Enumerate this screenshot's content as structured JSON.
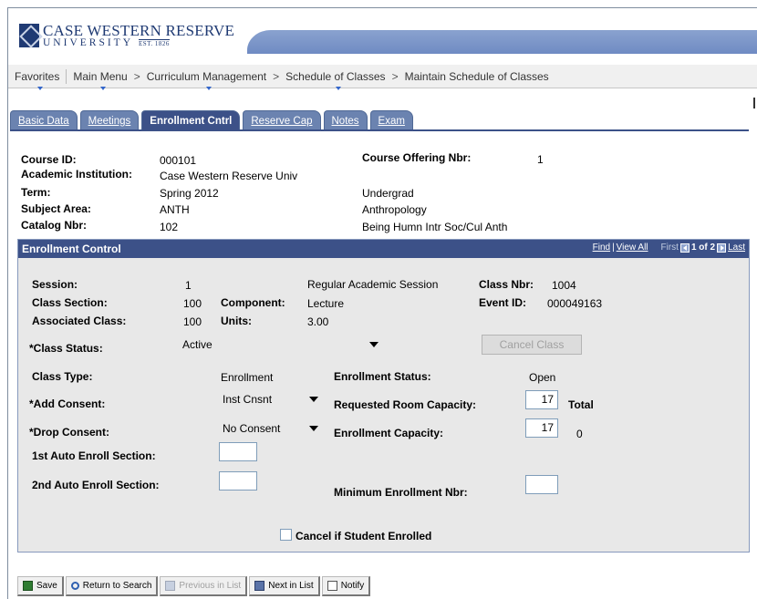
{
  "logo": {
    "line1": "CASE WESTERN RESERVE",
    "line2": "UNIVERSITY",
    "est": "EST. 1826"
  },
  "breadcrumb": {
    "favorites": "Favorites",
    "main_menu": "Main Menu",
    "sep": ">",
    "items": [
      "Curriculum Management",
      "Schedule of Classes",
      "Maintain Schedule of Classes"
    ]
  },
  "tabs": [
    "Basic Data",
    "Meetings",
    "Enrollment Cntrl",
    "Reserve Cap",
    "Notes",
    "Exam"
  ],
  "header_info": {
    "course_id_label": "Course ID:",
    "course_id": "000101",
    "offering_label": "Course Offering Nbr:",
    "offering": "1",
    "institution_label": "Academic Institution:",
    "institution": "Case Western Reserve Univ",
    "term_label": "Term:",
    "term": "Spring 2012",
    "career": "Undergrad",
    "subject_label": "Subject Area:",
    "subject": "ANTH",
    "subject_desc": "Anthropology",
    "catalog_label": "Catalog Nbr:",
    "catalog": "102",
    "catalog_desc": "Being Humn Intr Soc/Cul Anth"
  },
  "enrollment": {
    "title": "Enrollment Control",
    "find": "Find",
    "view_all": "View All",
    "first": "First",
    "pager": "1 of 2",
    "last": "Last",
    "session_label": "Session:",
    "session": "1",
    "session_desc": "Regular Academic Session",
    "class_nbr_label": "Class Nbr:",
    "class_nbr": "1004",
    "section_label": "Class Section:",
    "section": "100",
    "component_label": "Component:",
    "component": "Lecture",
    "event_label": "Event ID:",
    "event": "000049163",
    "assoc_label": "Associated Class:",
    "assoc": "100",
    "units_label": "Units:",
    "units": "3.00",
    "status_label": "*Class Status:",
    "status": "Active",
    "cancel_class": "Cancel Class",
    "type_label": "Class Type:",
    "type": "Enrollment",
    "enr_status_label": "Enrollment Status:",
    "enr_status": "Open",
    "add_label": "*Add Consent:",
    "add": "Inst Cnsnt",
    "room_cap_label": "Requested Room Capacity:",
    "room_cap": "17",
    "total": "Total",
    "drop_label": "*Drop Consent:",
    "drop": "No Consent",
    "enr_cap_label": "Enrollment Capacity:",
    "enr_cap": "17",
    "enr_total": "0",
    "auto1_label": "1st Auto Enroll Section:",
    "auto2_label": "2nd Auto Enroll Section:",
    "min_label": "Minimum Enrollment Nbr:",
    "cancel_if_label": "Cancel if Student Enrolled"
  },
  "toolbar": [
    "Save",
    "Return to Search",
    "Previous in List",
    "Next in List",
    "Notify"
  ]
}
